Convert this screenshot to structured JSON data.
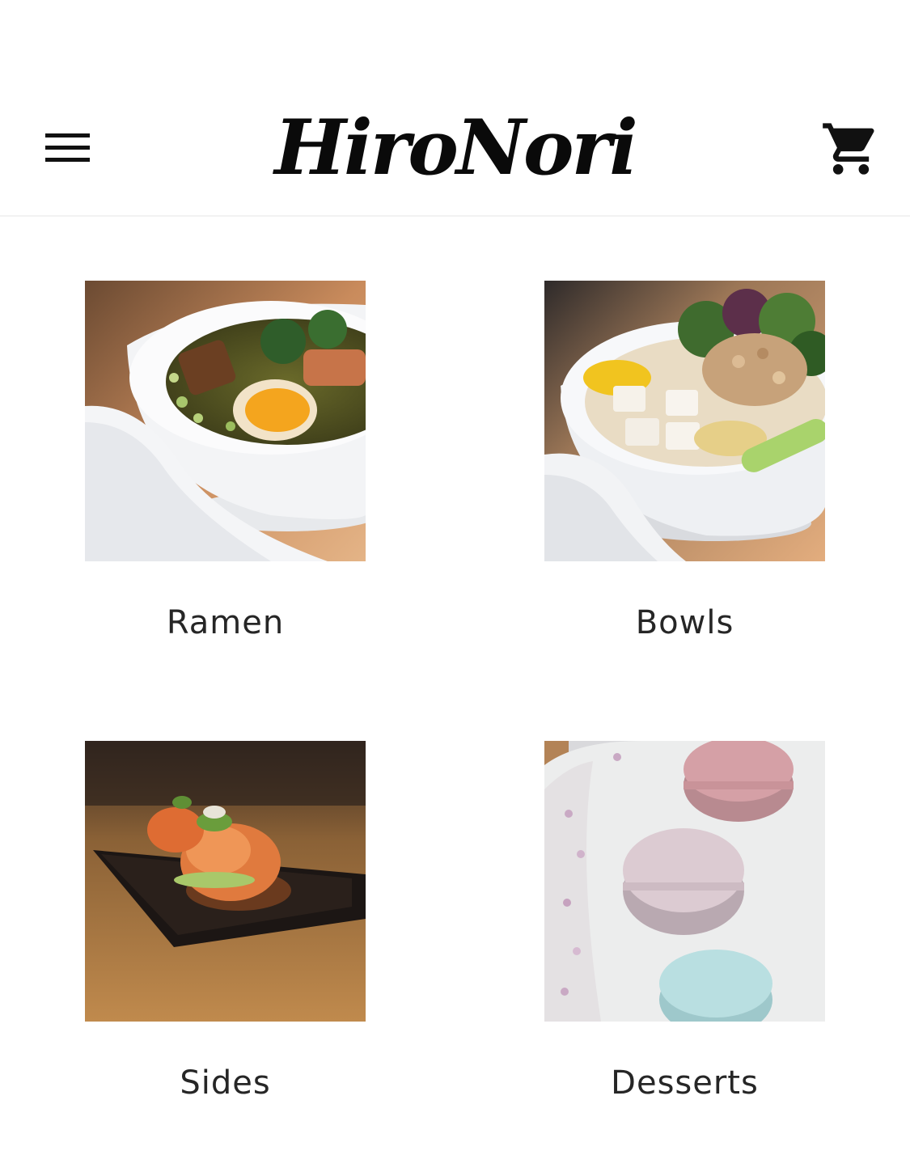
{
  "header": {
    "brand": "HiroNori",
    "menu_icon": "hamburger-menu-icon",
    "cart_icon": "shopping-cart-icon"
  },
  "categories": [
    {
      "label": "Ramen",
      "image": "ramen-photo"
    },
    {
      "label": "Bowls",
      "image": "bowl-photo"
    },
    {
      "label": "Sides",
      "image": "sides-photo"
    },
    {
      "label": "Desserts",
      "image": "macarons-photo"
    }
  ],
  "colors": {
    "background": "#ffffff",
    "text": "#262626",
    "brand": "#0a0a0a"
  }
}
